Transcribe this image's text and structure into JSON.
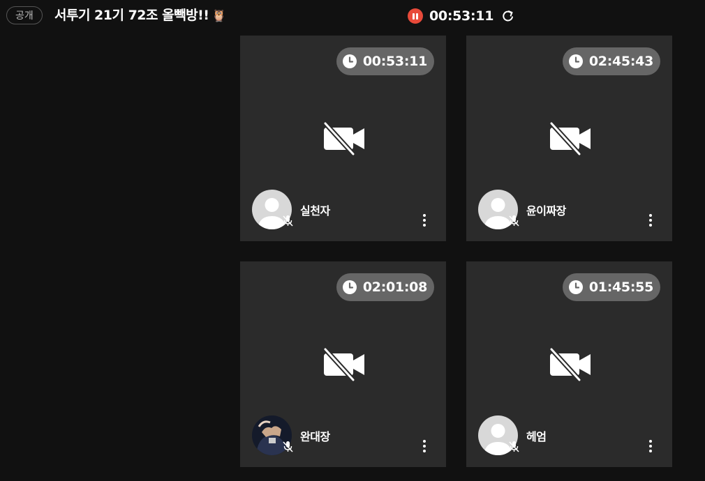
{
  "header": {
    "badge": "공개",
    "title": "서투기 21기 72조 올빽방!!",
    "title_emoji": "🦉",
    "timer": "00:53:11",
    "pause_icon": "pause-icon",
    "refresh_icon": "refresh-icon",
    "accent_color": "#e84a3a"
  },
  "participants": [
    {
      "name": "실천자",
      "time": "00:53:11",
      "avatar": "default"
    },
    {
      "name": "윤이짜장",
      "time": "02:45:43",
      "avatar": "default"
    },
    {
      "name": "완대장",
      "time": "02:01:08",
      "avatar": "photo"
    },
    {
      "name": "헤엄",
      "time": "01:45:55",
      "avatar": "default"
    }
  ]
}
